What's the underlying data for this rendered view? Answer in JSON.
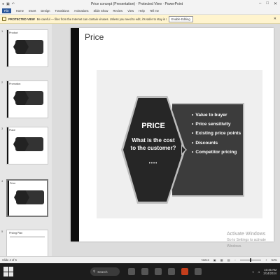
{
  "window": {
    "title": "Price concept (Presentation) · Protected View · PowerPoint"
  },
  "ribbon": {
    "tabs": [
      "File",
      "Home",
      "Insert",
      "Design",
      "Transitions",
      "Animations",
      "Slide Show",
      "Review",
      "View",
      "Help",
      "Tell me"
    ]
  },
  "protected_view": {
    "label": "PROTECTED VIEW",
    "message": "Be careful — files from the Internet can contain viruses. Unless you need to edit, it's safer to stay in Protected View.",
    "button": "Enable Editing"
  },
  "thumbnails": [
    {
      "num": "1",
      "title": "Product"
    },
    {
      "num": "2",
      "title": "Promotion"
    },
    {
      "num": "3",
      "title": "Place"
    },
    {
      "num": "4",
      "title": "Price"
    },
    {
      "num": "5",
      "title": "Pricing Plan"
    }
  ],
  "slide": {
    "title": "Price",
    "smartart": {
      "heading": "PRICE",
      "question_line1": "What is the cost",
      "question_line2": "to the customer?",
      "dots": "••••",
      "bullets": [
        "Value to buyer",
        "Price sensitivity",
        "Existing price points",
        "Discounts",
        "Competitor pricing"
      ]
    }
  },
  "watermark": {
    "line1": "Activate Windows",
    "line2": "Go to Settings to activate Windows."
  },
  "statusbar": {
    "slide_info": "Slide 4 of 5",
    "notes": "Notes",
    "zoom": "54%"
  },
  "taskbar": {
    "search": "Search",
    "time": "10:45 AM",
    "date": "3/14/2024"
  }
}
